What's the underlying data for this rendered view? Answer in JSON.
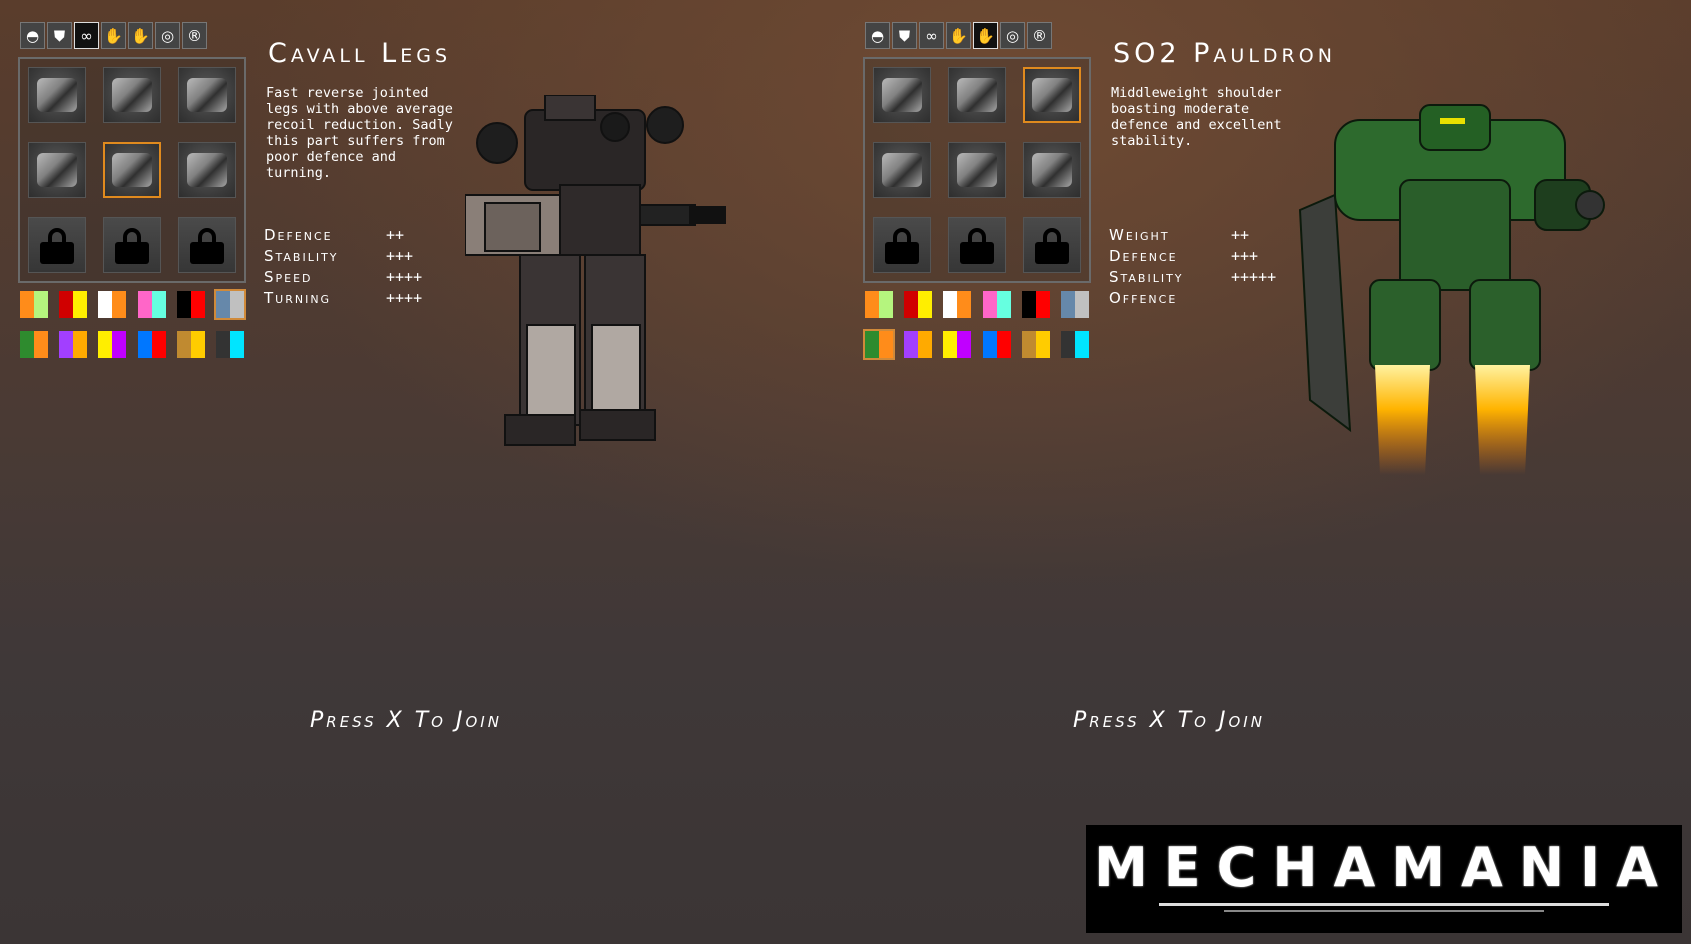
{
  "tab_icons": [
    "head-icon",
    "torso-icon",
    "legs-icon",
    "left-arm-icon",
    "right-arm-icon",
    "shoulder-icon",
    "core-icon"
  ],
  "tab_glyphs": [
    "◓",
    "⛊",
    "∞",
    "✋",
    "✋",
    "◎",
    "®"
  ],
  "palette": [
    [
      "#ff8c1a",
      "#b5f57e"
    ],
    [
      "#d00000",
      "#ffee00"
    ],
    [
      "#ffffff",
      "#ff8c1a"
    ],
    [
      "#ff66c8",
      "#66ffe0"
    ],
    [
      "#000000",
      "#ff0000"
    ],
    [
      "#6688aa",
      "#c0c0c0"
    ],
    [
      "#2e8b2e",
      "#ff8c1a"
    ],
    [
      "#a23fff",
      "#ffaa00"
    ],
    [
      "#ffee00",
      "#c000ff"
    ],
    [
      "#0077ff",
      "#ff0000"
    ],
    [
      "#c08a30",
      "#ffcc00"
    ],
    [
      "#333333",
      "#00e5ff"
    ]
  ],
  "left": {
    "active_tab": 2,
    "title": "Cavall Legs",
    "description": "Fast reverse jointed\nlegs with above average\nrecoil reduction. Sadly\nthis part suffers from\npoor defence and\nturning.",
    "stats": [
      {
        "name": "Defence",
        "value": "++"
      },
      {
        "name": "Stability",
        "value": "+++"
      },
      {
        "name": "Speed",
        "value": "++++"
      },
      {
        "name": "Turning",
        "value": "++++"
      }
    ],
    "selected_slot": 4,
    "join_text": "Press X To Join"
  },
  "right": {
    "active_tab": 4,
    "title": "SO2 Pauldron",
    "description": "Middleweight shoulder\nboasting moderate\ndefence and excellent\nstability.",
    "stats": [
      {
        "name": "Weight",
        "value": "++"
      },
      {
        "name": "Defence",
        "value": "+++"
      },
      {
        "name": "Stability",
        "value": "+++++"
      },
      {
        "name": "Offence",
        "value": ""
      }
    ],
    "selected_slot": 2,
    "join_text": "Press X To Join"
  },
  "logo": "MECHAMANIA"
}
